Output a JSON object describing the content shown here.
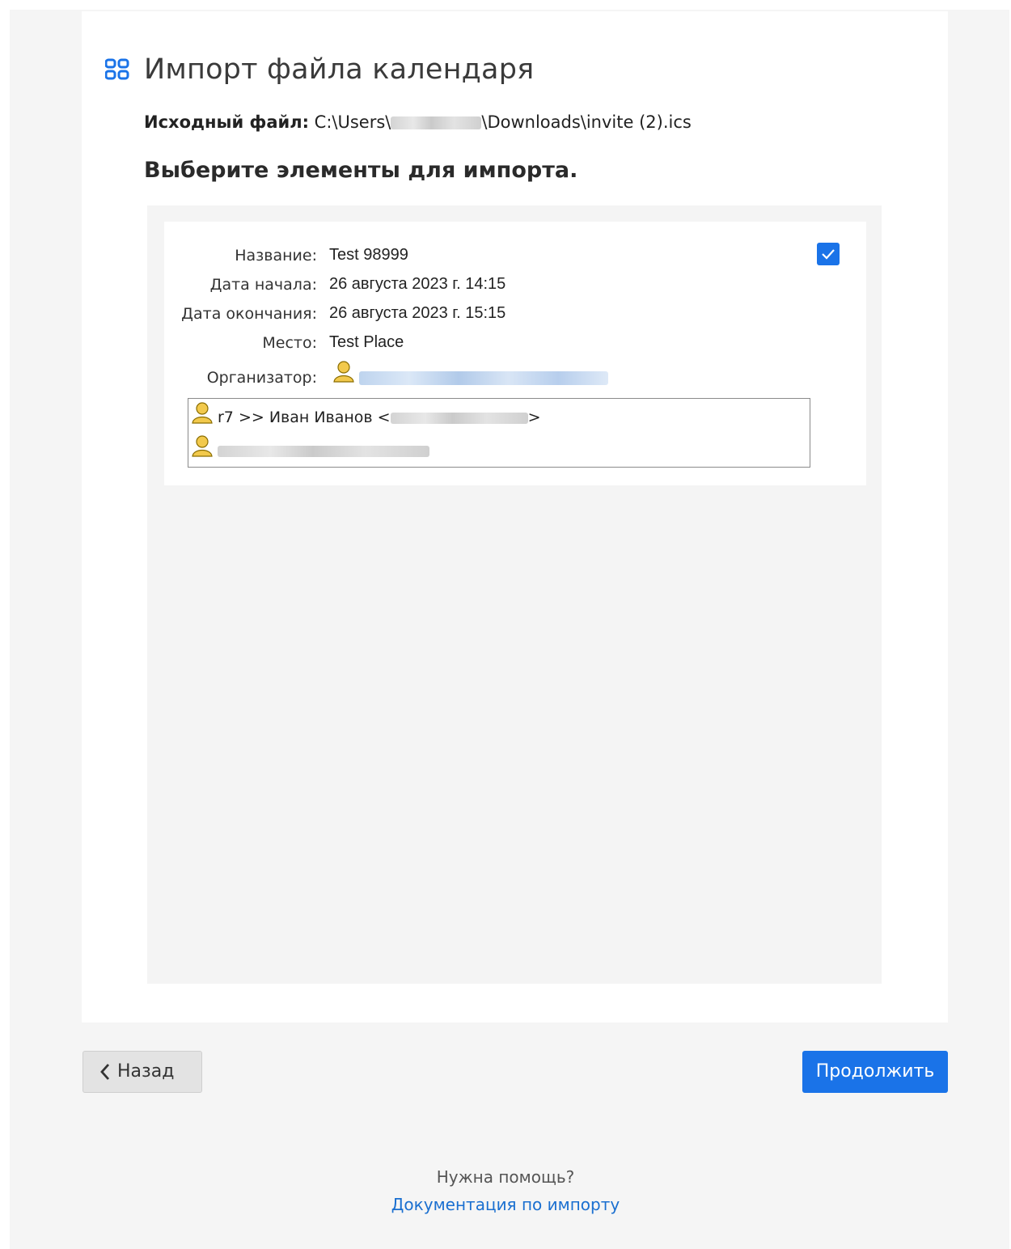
{
  "dialog": {
    "title": "Импорт файла календаря",
    "source_label": "Исходный файл:",
    "source_path_prefix": "C:\\Users\\",
    "source_path_suffix": "\\Downloads\\invite (2).ics",
    "subtitle": "Выберите элементы для импорта."
  },
  "event": {
    "checked": true,
    "fields": {
      "title_label": "Название:",
      "title_value": "Test 98999",
      "start_label": "Дата начала:",
      "start_value": "26 августа 2023 г. 14:15",
      "end_label": "Дата окончания:",
      "end_value": "26 августа 2023 г. 15:15",
      "place_label": "Место:",
      "place_value": "Test Place",
      "organizer_label": "Организатор:"
    },
    "attendees": [
      {
        "name_prefix": "r7 >> Иван Иванов <",
        "name_suffix": ">"
      }
    ]
  },
  "footer": {
    "back_label": "Назад",
    "continue_label": "Продолжить",
    "help_text": "Нужна помощь?",
    "help_link": "Документация по импорту"
  },
  "colors": {
    "accent": "#1a73e8",
    "person_icon": "#f2c94c"
  },
  "icons": {
    "header": "grid-icon",
    "organizer": "person-icon",
    "back": "chevron-left-icon",
    "checkbox": "checkmark-icon"
  }
}
